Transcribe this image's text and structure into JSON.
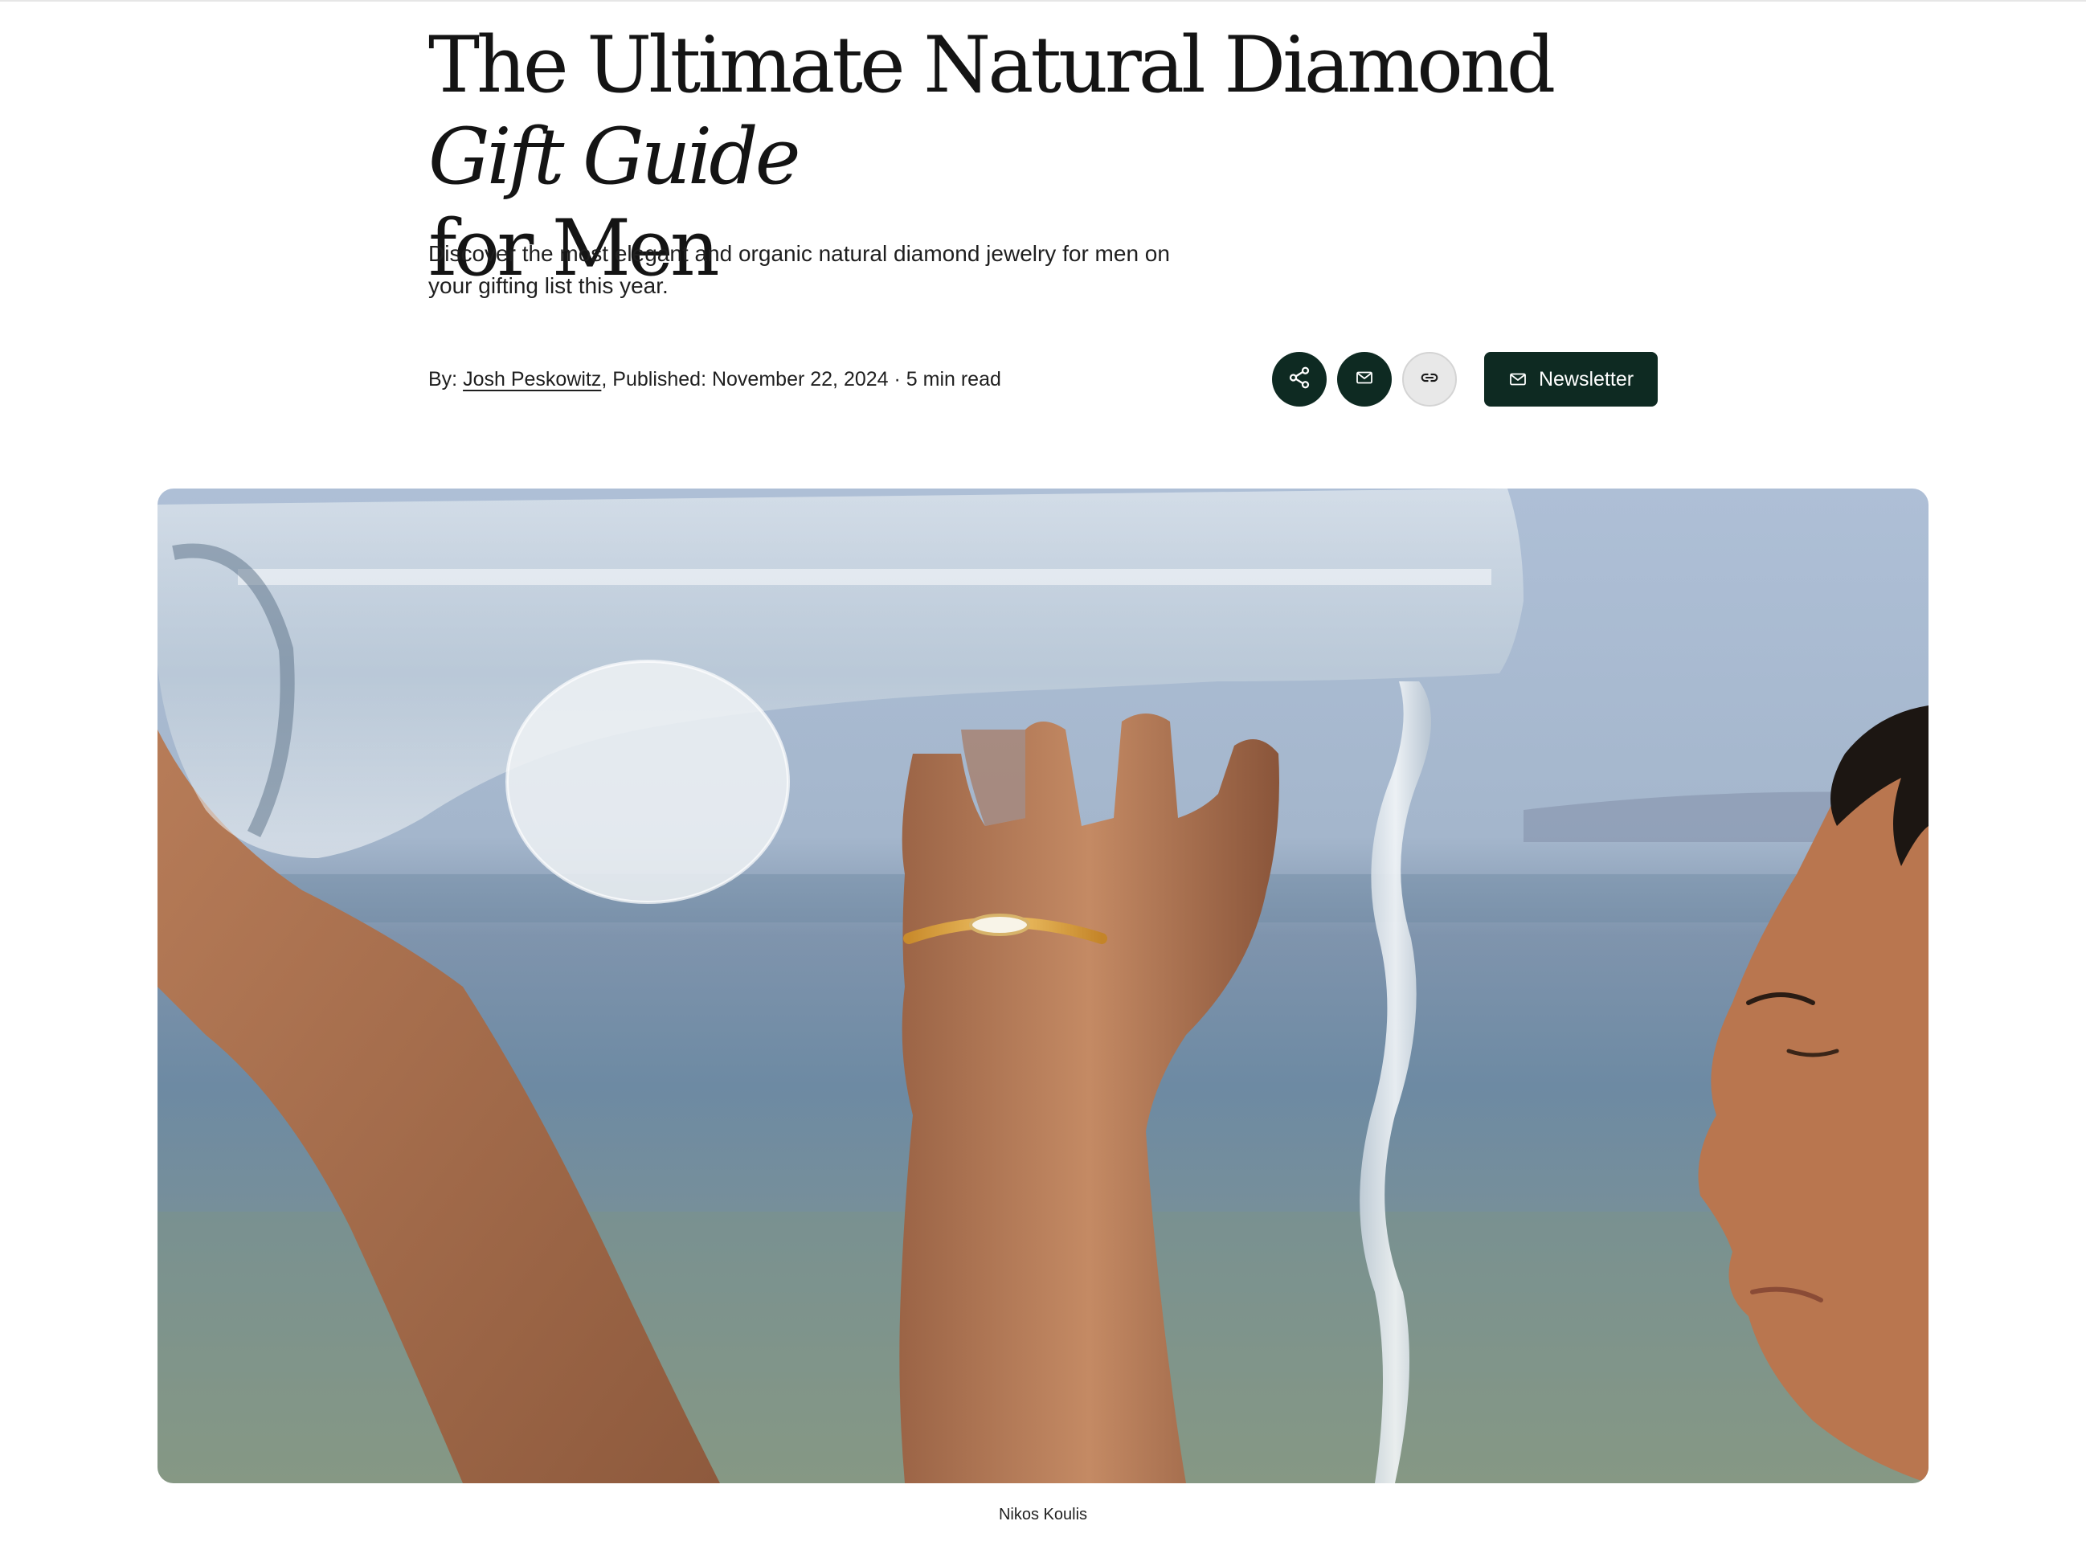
{
  "article": {
    "title_main": "The Ultimate Natural Diamond ",
    "title_italic": "Gift Guide",
    "title_end": "for Men",
    "dek": "Discover the most elegant and organic natural diamond jewelry for men on your gifting list this year.",
    "byline": {
      "by_label": "By:",
      "author": "Josh Peskowitz",
      "separator": ",",
      "published": "Published: November 22, 2024 · 5 min read"
    }
  },
  "actions": {
    "share_icon": "share-icon",
    "email_icon": "mail-icon",
    "link_icon": "link-icon",
    "newsletter_label": "Newsletter",
    "accent_color": "#0e2a22"
  },
  "hero": {
    "caption": "Nikos Koulis"
  }
}
